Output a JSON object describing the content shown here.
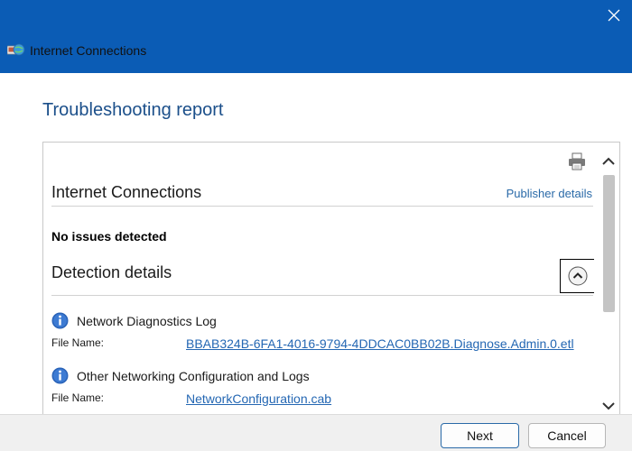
{
  "window": {
    "title": "Internet Connections",
    "accent_color": "#0b5cb5",
    "icons": {
      "app": "internet-connections-icon",
      "close": "close-icon"
    }
  },
  "page": {
    "title": "Troubleshooting report"
  },
  "report": {
    "title": "Internet Connections",
    "publisher_link": "Publisher details",
    "status": "No issues detected",
    "details_title": "Detection details",
    "icons": {
      "print": "printer-icon",
      "collapse": "chevron-up-icon",
      "info": "info-icon"
    },
    "items": [
      {
        "title": "Network Diagnostics Log",
        "file_label": "File Name:",
        "file_name": "BBAB324B-6FA1-4016-9794-4DDCAC0BB02B.Diagnose.Admin.0.etl"
      },
      {
        "title": "Other Networking Configuration and Logs",
        "file_label": "File Name:",
        "file_name": "NetworkConfiguration.cab"
      }
    ]
  },
  "footer": {
    "next_label": "Next",
    "cancel_label": "Cancel"
  }
}
